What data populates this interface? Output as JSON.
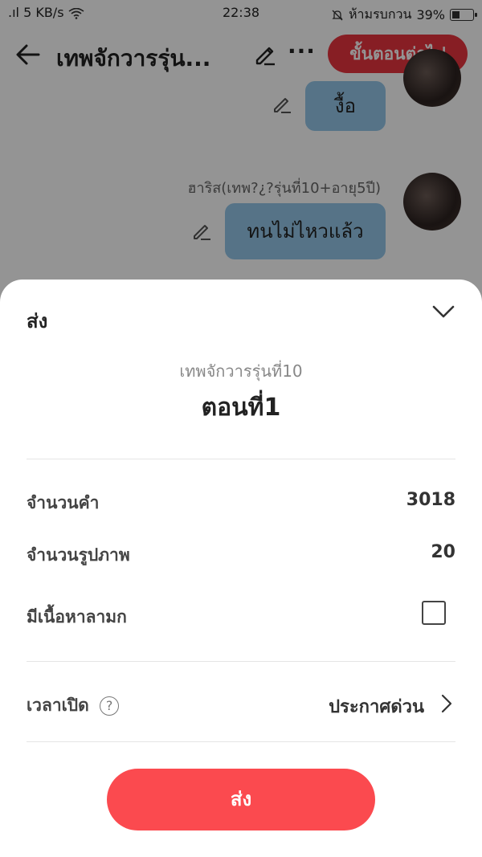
{
  "status_bar": {
    "left": ".ıl 5 KB/s",
    "time": "22:38",
    "dnd": "ห้ามรบกวน",
    "battery": "39%",
    "battery_level": 0.39
  },
  "header": {
    "title": "เทพจักวารรุ่น...",
    "next_button": "ขั้นตอนต่อไป"
  },
  "chat": {
    "messages": [
      {
        "text": "งื้อ"
      },
      {
        "sender": "ฮาริส(เทพ?¿?รุ่นที่10+อายุ5ปี)",
        "text": "ทนไม่ไหวแล้ว"
      }
    ]
  },
  "sheet": {
    "title": "ส่ง",
    "novel_name": "เทพจักวารรุ่นที่10",
    "chapter_name": "ตอนที่1",
    "word_count_label": "จำนวนคำ",
    "word_count": "3018",
    "image_count_label": "จำนวนรูปภาพ",
    "image_count": "20",
    "adult_content_label": "มีเนื้อหาลามก",
    "adult_content_checked": false,
    "publish_time_label": "เวลาเปิด",
    "publish_time_value": "ประกาศด่วน",
    "submit_button": "ส่ง"
  },
  "colors": {
    "accent_red": "#e8353f",
    "submit_red": "#fb4a4f",
    "bubble_blue": "#95c7e8"
  }
}
